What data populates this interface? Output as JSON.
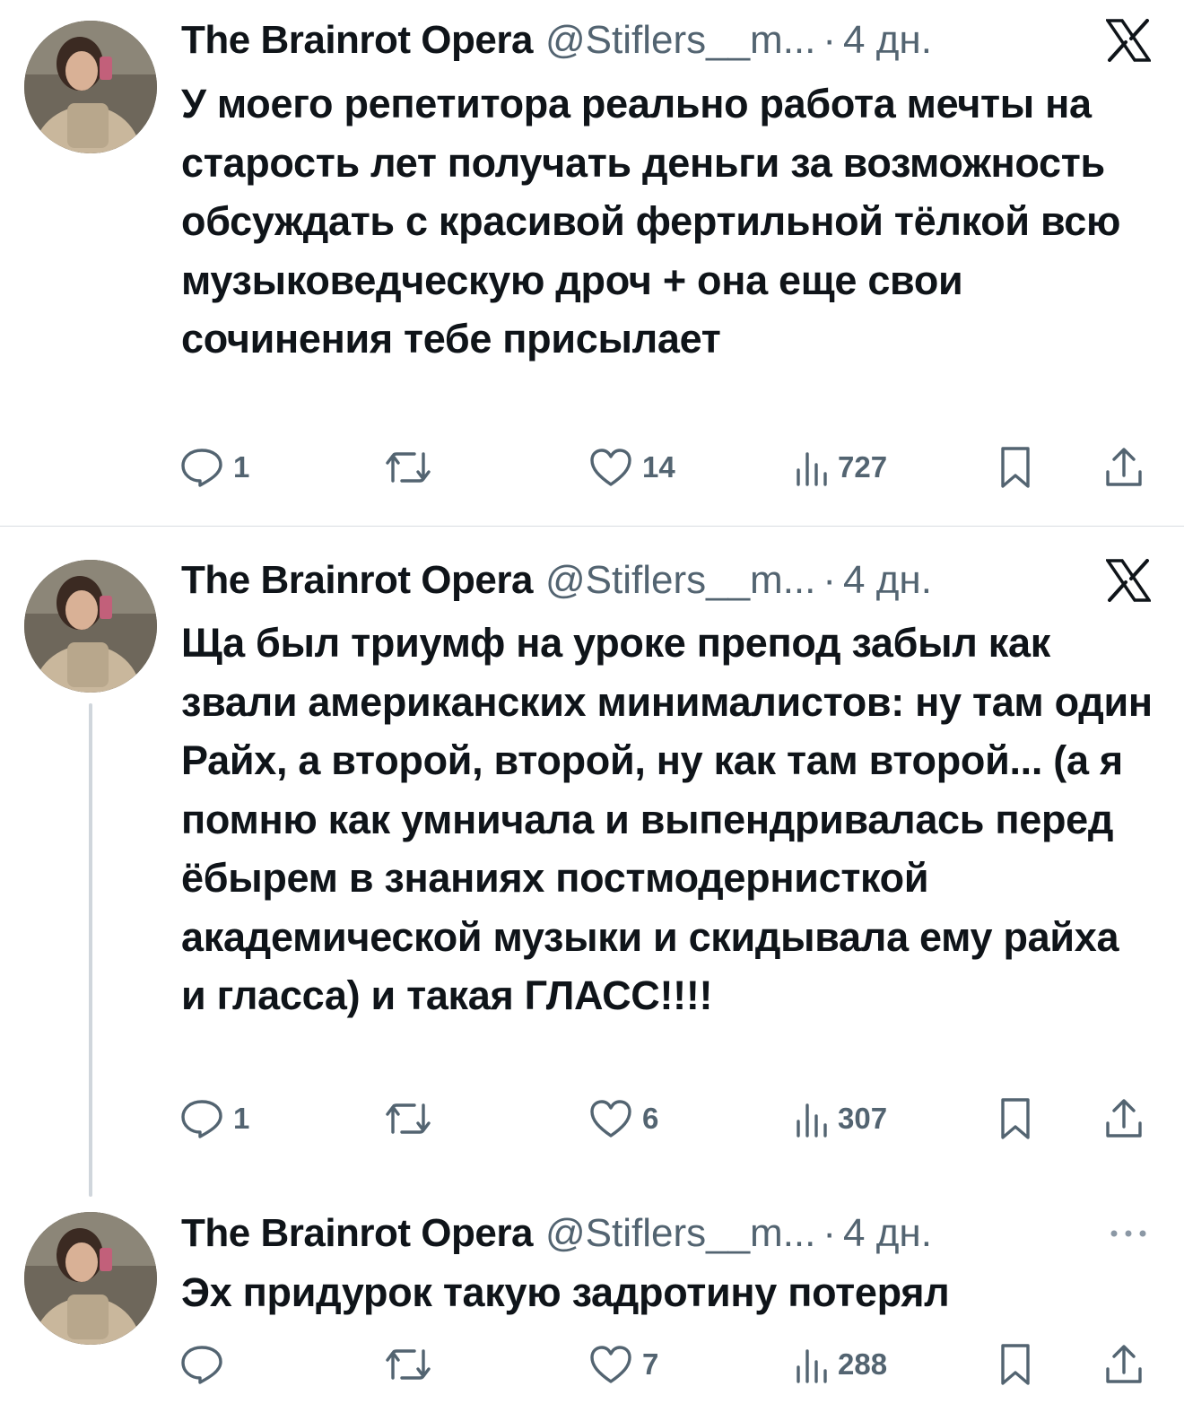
{
  "tweets": [
    {
      "author": "The Brainrot Opera",
      "handle": "@Stiflers__m...",
      "separator": "·",
      "time": "4 дн.",
      "corner_icon": "x-logo-icon",
      "text": "У моего репетитора реально работа мечты на старость лет получать деньги за возможность обсуждать с красивой фертильной тёлкой всю музыковедческую дроч + она еще свои сочинения тебе присылает",
      "replies": "1",
      "reposts": "",
      "likes": "14",
      "views": "727"
    },
    {
      "author": "The Brainrot Opera",
      "handle": "@Stiflers__m...",
      "separator": "·",
      "time": "4 дн.",
      "corner_icon": "x-logo-icon",
      "text": "Ща был триумф на уроке препод забыл как звали американских минималистов: ну там один Райх, а второй, второй, ну как там второй... (а я помню как умничала и выпендривалась перед ёбырем в знаниях постмодернисткой академической музыки и скидывала ему райха и гласса) и такая ГЛАСС!!!!",
      "replies": "1",
      "reposts": "",
      "likes": "6",
      "views": "307"
    },
    {
      "author": "The Brainrot Opera",
      "handle": "@Stiflers__m...",
      "separator": "·",
      "time": "4 дн.",
      "corner_icon": "more-icon",
      "text": "Эх придурок такую задротину потерял",
      "replies": "",
      "reposts": "",
      "likes": "7",
      "views": "288"
    }
  ],
  "colors": {
    "text_primary": "#0f1419",
    "text_secondary": "#536471",
    "divider": "#d9dde1",
    "thread_line": "#d0d6dc"
  }
}
